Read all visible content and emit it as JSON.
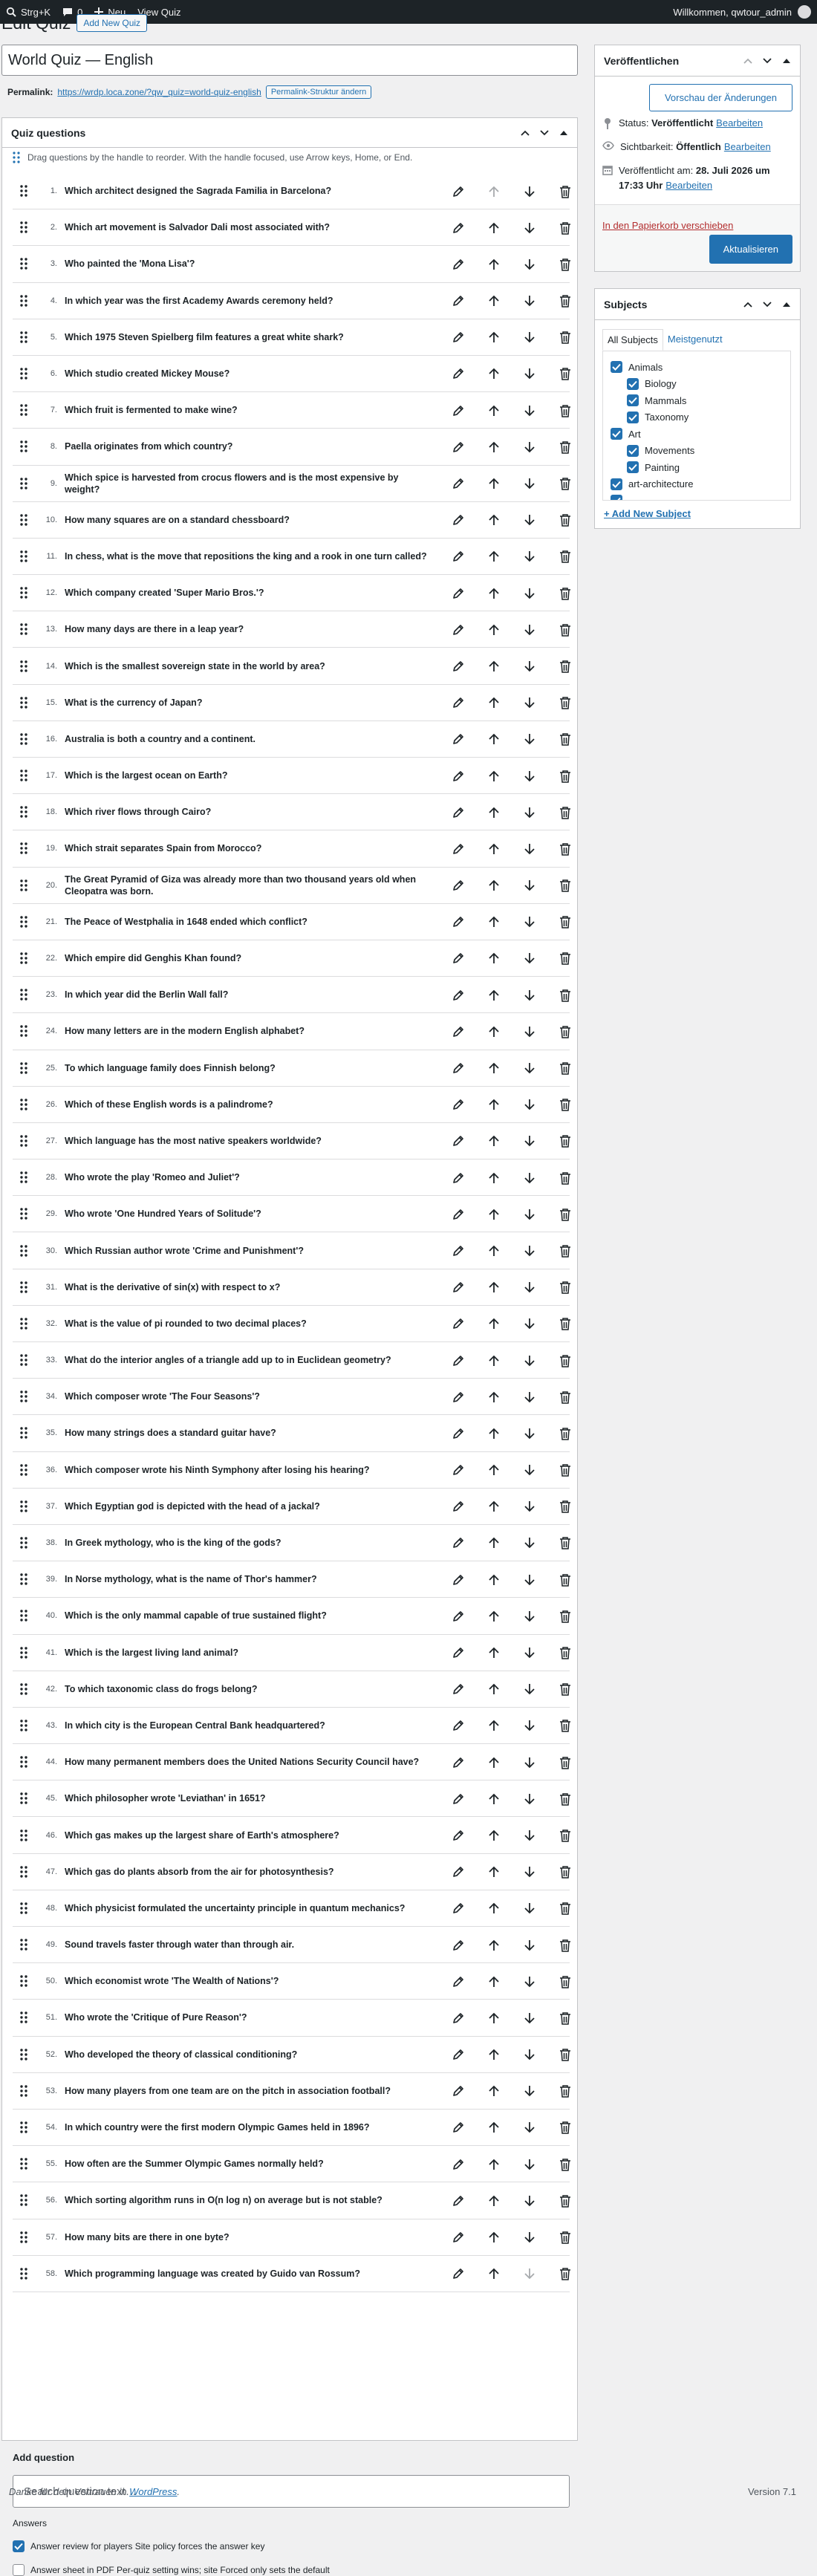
{
  "adminbar": {
    "shortcut": "Strg+K",
    "comments_count": "0",
    "new_label": "Neu",
    "view_label": "View Quiz",
    "greeting": "Willkommen, qwtour_admin"
  },
  "page": {
    "heading": "Edit Quiz",
    "add_new_label": "Add New Quiz",
    "title_value": "World Quiz — English",
    "permalink_label": "Permalink:",
    "permalink_url": "https://wrdp.loca.zone/?qw_quiz=world-quiz-english",
    "permalink_button": "Permalink-Struktur ändern"
  },
  "quiz_box": {
    "title": "Quiz questions",
    "hint": "Drag questions by the handle to reorder. With the handle focused, use Arrow keys, Home, or End.",
    "questions": [
      {
        "n": "1.",
        "text": "Which architect designed the Sagrada Familia in Barcelona?"
      },
      {
        "n": "2.",
        "text": "Which art movement is Salvador Dali most associated with?"
      },
      {
        "n": "3.",
        "text": "Who painted the 'Mona Lisa'?"
      },
      {
        "n": "4.",
        "text": "In which year was the first Academy Awards ceremony held?"
      },
      {
        "n": "5.",
        "text": "Which 1975 Steven Spielberg film features a great white shark?"
      },
      {
        "n": "6.",
        "text": "Which studio created Mickey Mouse?"
      },
      {
        "n": "7.",
        "text": "Which fruit is fermented to make wine?"
      },
      {
        "n": "8.",
        "text": "Paella originates from which country?"
      },
      {
        "n": "9.",
        "text": "Which spice is harvested from crocus flowers and is the most expensive by weight?"
      },
      {
        "n": "10.",
        "text": "How many squares are on a standard chessboard?"
      },
      {
        "n": "11.",
        "text": "In chess, what is the move that repositions the king and a rook in one turn called?"
      },
      {
        "n": "12.",
        "text": "Which company created 'Super Mario Bros.'?"
      },
      {
        "n": "13.",
        "text": "How many days are there in a leap year?"
      },
      {
        "n": "14.",
        "text": "Which is the smallest sovereign state in the world by area?"
      },
      {
        "n": "15.",
        "text": "What is the currency of Japan?"
      },
      {
        "n": "16.",
        "text": "Australia is both a country and a continent."
      },
      {
        "n": "17.",
        "text": "Which is the largest ocean on Earth?"
      },
      {
        "n": "18.",
        "text": "Which river flows through Cairo?"
      },
      {
        "n": "19.",
        "text": "Which strait separates Spain from Morocco?"
      },
      {
        "n": "20.",
        "text": "The Great Pyramid of Giza was already more than two thousand years old when Cleopatra was born."
      },
      {
        "n": "21.",
        "text": "The Peace of Westphalia in 1648 ended which conflict?"
      },
      {
        "n": "22.",
        "text": "Which empire did Genghis Khan found?"
      },
      {
        "n": "23.",
        "text": "In which year did the Berlin Wall fall?"
      },
      {
        "n": "24.",
        "text": "How many letters are in the modern English alphabet?"
      },
      {
        "n": "25.",
        "text": "To which language family does Finnish belong?"
      },
      {
        "n": "26.",
        "text": "Which of these English words is a palindrome?"
      },
      {
        "n": "27.",
        "text": "Which language has the most native speakers worldwide?"
      },
      {
        "n": "28.",
        "text": "Who wrote the play 'Romeo and Juliet'?"
      },
      {
        "n": "29.",
        "text": "Who wrote 'One Hundred Years of Solitude'?"
      },
      {
        "n": "30.",
        "text": "Which Russian author wrote 'Crime and Punishment'?"
      },
      {
        "n": "31.",
        "text": "What is the derivative of sin(x) with respect to x?"
      },
      {
        "n": "32.",
        "text": "What is the value of pi rounded to two decimal places?"
      },
      {
        "n": "33.",
        "text": "What do the interior angles of a triangle add up to in Euclidean geometry?"
      },
      {
        "n": "34.",
        "text": "Which composer wrote 'The Four Seasons'?"
      },
      {
        "n": "35.",
        "text": "How many strings does a standard guitar have?"
      },
      {
        "n": "36.",
        "text": "Which composer wrote his Ninth Symphony after losing his hearing?"
      },
      {
        "n": "37.",
        "text": "Which Egyptian god is depicted with the head of a jackal?"
      },
      {
        "n": "38.",
        "text": "In Greek mythology, who is the king of the gods?"
      },
      {
        "n": "39.",
        "text": "In Norse mythology, what is the name of Thor's hammer?"
      },
      {
        "n": "40.",
        "text": "Which is the only mammal capable of true sustained flight?"
      },
      {
        "n": "41.",
        "text": "Which is the largest living land animal?"
      },
      {
        "n": "42.",
        "text": "To which taxonomic class do frogs belong?"
      },
      {
        "n": "43.",
        "text": "In which city is the European Central Bank headquartered?"
      },
      {
        "n": "44.",
        "text": "How many permanent members does the United Nations Security Council have?"
      },
      {
        "n": "45.",
        "text": "Which philosopher wrote 'Leviathan' in 1651?"
      },
      {
        "n": "46.",
        "text": "Which gas makes up the largest share of Earth's atmosphere?"
      },
      {
        "n": "47.",
        "text": "Which gas do plants absorb from the air for photosynthesis?"
      },
      {
        "n": "48.",
        "text": "Which physicist formulated the uncertainty principle in quantum mechanics?"
      },
      {
        "n": "49.",
        "text": "Sound travels faster through water than through air."
      },
      {
        "n": "50.",
        "text": "Which economist wrote 'The Wealth of Nations'?"
      },
      {
        "n": "51.",
        "text": "Who wrote the 'Critique of Pure Reason'?"
      },
      {
        "n": "52.",
        "text": "Who developed the theory of classical conditioning?"
      },
      {
        "n": "53.",
        "text": "How many players from one team are on the pitch in association football?"
      },
      {
        "n": "54.",
        "text": "In which country were the first modern Olympic Games held in 1896?"
      },
      {
        "n": "55.",
        "text": "How often are the Summer Olympic Games normally held?"
      },
      {
        "n": "56.",
        "text": "Which sorting algorithm runs in O(n log n) on average but is not stable?"
      },
      {
        "n": "57.",
        "text": "How many bits are there in one byte?"
      },
      {
        "n": "58.",
        "text": "Which programming language was created by Guido van Rossum?"
      }
    ],
    "add_question_title": "Add question",
    "search_placeholder": "Search question text…",
    "answers_label": "Answers",
    "option_review": "Answer review for players Site policy forces the answer key",
    "option_sheet": "Answer sheet in PDF Per-quiz setting wins; site Forced only sets the default"
  },
  "publish": {
    "title": "Veröffentlichen",
    "preview_label": "Vorschau der Änderungen",
    "status_label": "Status:",
    "status_value": "Veröffentlicht",
    "status_edit": "Bearbeiten",
    "visibility_label": "Sichtbarkeit:",
    "visibility_value": "Öffentlich",
    "visibility_edit": "Bearbeiten",
    "published_label": "Veröffentlicht am:",
    "published_date": "28. Juli 2026 um",
    "published_time": "17:33 Uhr",
    "published_edit": "Bearbeiten",
    "trash_label": "In den Papierkorb verschieben",
    "update_label": "Aktualisieren"
  },
  "subjects": {
    "title": "Subjects",
    "tab_all": "All Subjects",
    "tab_popular": "Meistgenutzt",
    "items": [
      {
        "label": "Animals",
        "checked": true,
        "child": false
      },
      {
        "label": "Biology",
        "checked": true,
        "child": true
      },
      {
        "label": "Mammals",
        "checked": true,
        "child": true
      },
      {
        "label": "Taxonomy",
        "checked": true,
        "child": true
      },
      {
        "label": "Art",
        "checked": true,
        "child": false
      },
      {
        "label": "Movements",
        "checked": true,
        "child": true
      },
      {
        "label": "Painting",
        "checked": true,
        "child": true
      },
      {
        "label": "art-architecture",
        "checked": true,
        "child": false
      },
      {
        "label": "",
        "checked": true,
        "child": false
      }
    ],
    "add_new_label": "+ Add New Subject"
  },
  "footer": {
    "thanks_prefix": "Danke für dein Vertrauen in ",
    "wordpress": "WordPress",
    "thanks_suffix": ".",
    "version": "Version 7.1"
  },
  "colors": {
    "accent": "#2271b1",
    "adminbar": "#1d2327",
    "danger": "#b32d2e",
    "background": "#f0f0f1"
  }
}
